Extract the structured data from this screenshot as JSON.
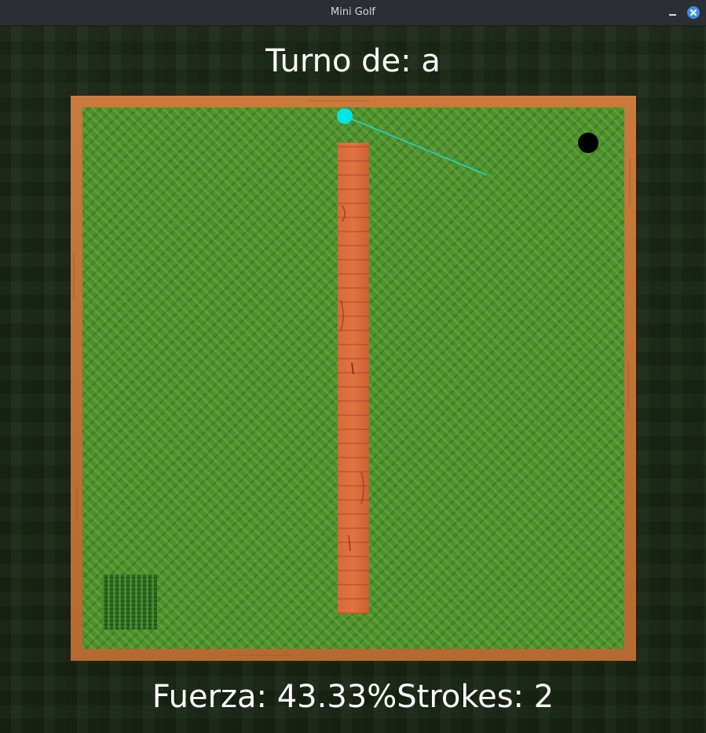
{
  "window": {
    "title": "Mini Golf"
  },
  "hud": {
    "turn_prefix": "Turno de: ",
    "turn_player": "a",
    "force_prefix": "Fuerza: ",
    "force_value": "43.33%",
    "strokes_prefix": "Strokes: ",
    "strokes_value": "2"
  },
  "game_state": {
    "force_percent": 43.33,
    "strokes": 2,
    "current_player": "a"
  },
  "colors": {
    "ball": "#00e5e5",
    "aim_line": "#22d3d3",
    "hole": "#000000",
    "frame_wood": "#c2743a",
    "wall_wood": "#dc6b3c",
    "grass": "#4e8f2e",
    "rough": "#2f6a22"
  },
  "icons": {
    "minimize": "minimize-icon",
    "close": "close-icon"
  }
}
